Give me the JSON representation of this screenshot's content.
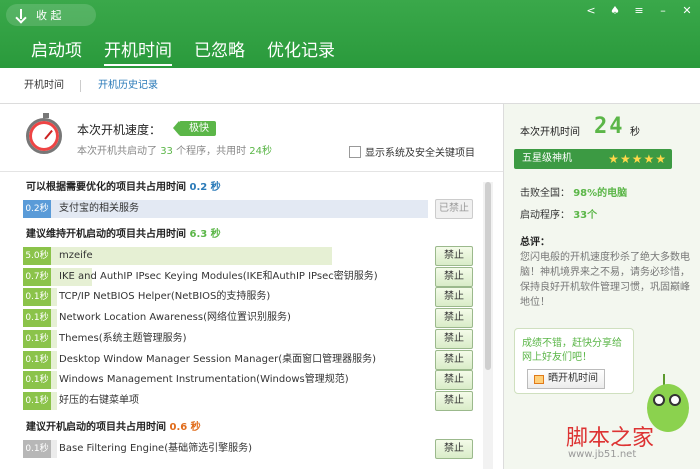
{
  "header": {
    "collapse_label": "收 起",
    "tabs": [
      "启动项",
      "开机时间",
      "已忽略",
      "优化记录"
    ],
    "active_tab": "开机时间"
  },
  "subnav": {
    "tab1": "开机时间",
    "tab2": "开机历史记录"
  },
  "summary": {
    "title": "本次开机速度：",
    "badge": "极快",
    "detail_prefix": "本次开机共启动了",
    "program_count": "33",
    "detail_mid": "个程序，共用时",
    "time": "24秒",
    "show_system_label": "显示系统及安全关键项目"
  },
  "sections": [
    {
      "title": "可以根据需要优化的项目共占用时间",
      "time": "0.2 秒",
      "items": [
        {
          "time": "0.2秒",
          "name": "支付宝的相关服务",
          "button": "已禁止",
          "disabled": true,
          "fill": 0.04
        }
      ]
    },
    {
      "title": "建议维持开机启动的项目共占用时间",
      "time": "6.3 秒",
      "items": [
        {
          "time": "5.0秒",
          "name": "mzeife",
          "button": "禁止",
          "fill": 0.9
        },
        {
          "time": "0.7秒",
          "name": "IKE and AuthIP IPsec Keying Modules(IKE和AuthIP IPsec密钥服务)",
          "button": "禁止",
          "fill": 0.13
        },
        {
          "time": "0.1秒",
          "name": "TCP/IP NetBIOS Helper(NetBIOS的支持服务)",
          "button": "禁止",
          "fill": 0.02
        },
        {
          "time": "0.1秒",
          "name": "Network Location Awareness(网络位置识别服务)",
          "button": "禁止",
          "fill": 0.02
        },
        {
          "time": "0.1秒",
          "name": "Themes(系统主题管理服务)",
          "button": "禁止",
          "fill": 0.02
        },
        {
          "time": "0.1秒",
          "name": "Desktop Window Manager Session Manager(桌面窗口管理器服务)",
          "button": "禁止",
          "fill": 0.02
        },
        {
          "time": "0.1秒",
          "name": "Windows Management Instrumentation(Windows管理规范)",
          "button": "禁止",
          "fill": 0.02
        },
        {
          "time": "0.1秒",
          "name": "好压的右键菜单项",
          "button": "禁止",
          "fill": 0.02
        }
      ]
    },
    {
      "title": "建议开机启动的项目共占用时间",
      "time": "0.6 秒",
      "items": [
        {
          "time": "0.1秒",
          "name": "Base Filtering Engine(基础筛选引擎服务)",
          "button": "禁止",
          "fill": 0.02
        }
      ]
    }
  ],
  "right": {
    "boot_time_label": "本次开机时间",
    "boot_time_value": "24",
    "boot_time_unit": "秒",
    "rank": "五星级神机",
    "stars": 5,
    "beat_label": "击败全国：",
    "beat_value": "98%的电脑",
    "programs_label": "启动程序：",
    "programs_value": "33个",
    "comment_title": "总评：",
    "comment": "您闪电般的开机速度秒杀了绝大多数电脑！神机境界来之不易，请务必珍惜，保持良好开机软件管理习惯，巩固巅峰地位！",
    "share_text": "成绩不错，赶快分享给网上好友们吧！",
    "share_button": "晒开机时间"
  },
  "watermark": {
    "text": "脚本之家",
    "url": "www.jb51.net"
  },
  "colors": {
    "header": "#2fa040",
    "accent_green": "#5bb648",
    "accent_blue": "#2a7ab8",
    "accent_orange": "#e06b1a"
  }
}
